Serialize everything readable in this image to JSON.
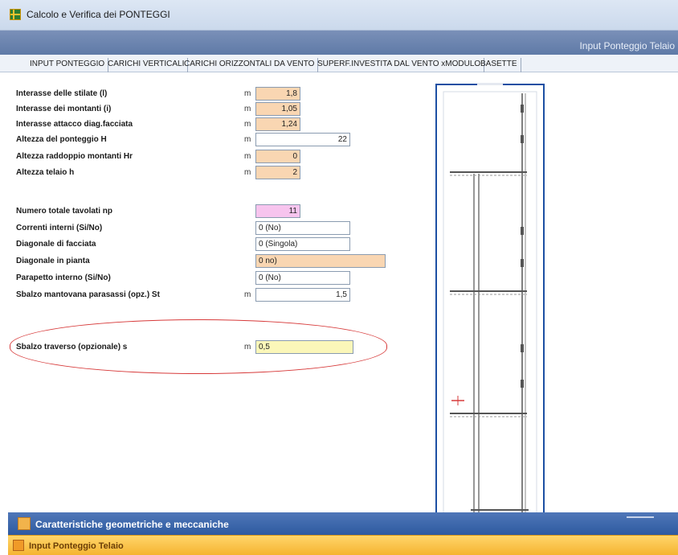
{
  "window": {
    "title": "Calcolo e Verifica dei PONTEGGI"
  },
  "header": {
    "title": "Input Ponteggio Telaio"
  },
  "tabs": [
    {
      "label": "INPUT PONTEGGIO"
    },
    {
      "label": "CARICHI VERTICALI"
    },
    {
      "label": "CARICHI ORIZZONTALI DA VENTO"
    },
    {
      "label": "SUPERF.INVESTITA DAL VENTO xMODULO"
    },
    {
      "label": "BASETTE"
    }
  ],
  "form": {
    "rows": [
      {
        "label": "Interasse delle stilate (l)",
        "unit": "m",
        "value": "1,8"
      },
      {
        "label": "Interasse dei montanti  (i)",
        "unit": "m",
        "value": "1,05"
      },
      {
        "label": "Interasse attacco diag.facciata",
        "unit": "m",
        "value": "1,24"
      },
      {
        "label": "Altezza del ponteggio H",
        "unit": "m",
        "value": "22"
      },
      {
        "label": "Altezza raddoppio montanti  Hr",
        "unit": "m",
        "value": "0"
      },
      {
        "label": "Altezza telaio  h",
        "unit": "m",
        "value": "2"
      },
      {
        "label": "Numero totale tavolati    np",
        "unit": "",
        "value": "11"
      },
      {
        "label": "Correnti interni (Si/No)",
        "unit": "",
        "value": "0 (No)"
      },
      {
        "label": "Diagonale di facciata",
        "unit": "",
        "value": "0 (Singola)"
      },
      {
        "label": "Diagonale in pianta",
        "unit": "",
        "value": "0 no)"
      },
      {
        "label": "Parapetto interno       (Si/No)",
        "unit": "",
        "value": "0 (No)"
      },
      {
        "label": "Sbalzo mantovana parasassi (opz.) St",
        "unit": "m",
        "value": "1,5"
      },
      {
        "label": "Sbalzo traverso (opzionale) s",
        "unit": "m",
        "value": "0,5"
      }
    ]
  },
  "bottom_bar": {
    "label": "Caratteristiche geometriche e meccaniche"
  },
  "status_bar": {
    "label": "Input Ponteggio Telaio"
  },
  "colors": {
    "orange_field": "#f9d6b2",
    "pink_field": "#f7c4ee",
    "yellow_field": "#fbf7b9",
    "accent_blue": "#1c4fa3",
    "highlight_red": "#d73a3a",
    "status_orange": "#f5b431"
  },
  "icons": {
    "app": "scaffold-icon",
    "section": "geometry-icon",
    "status": "frame-icon"
  }
}
